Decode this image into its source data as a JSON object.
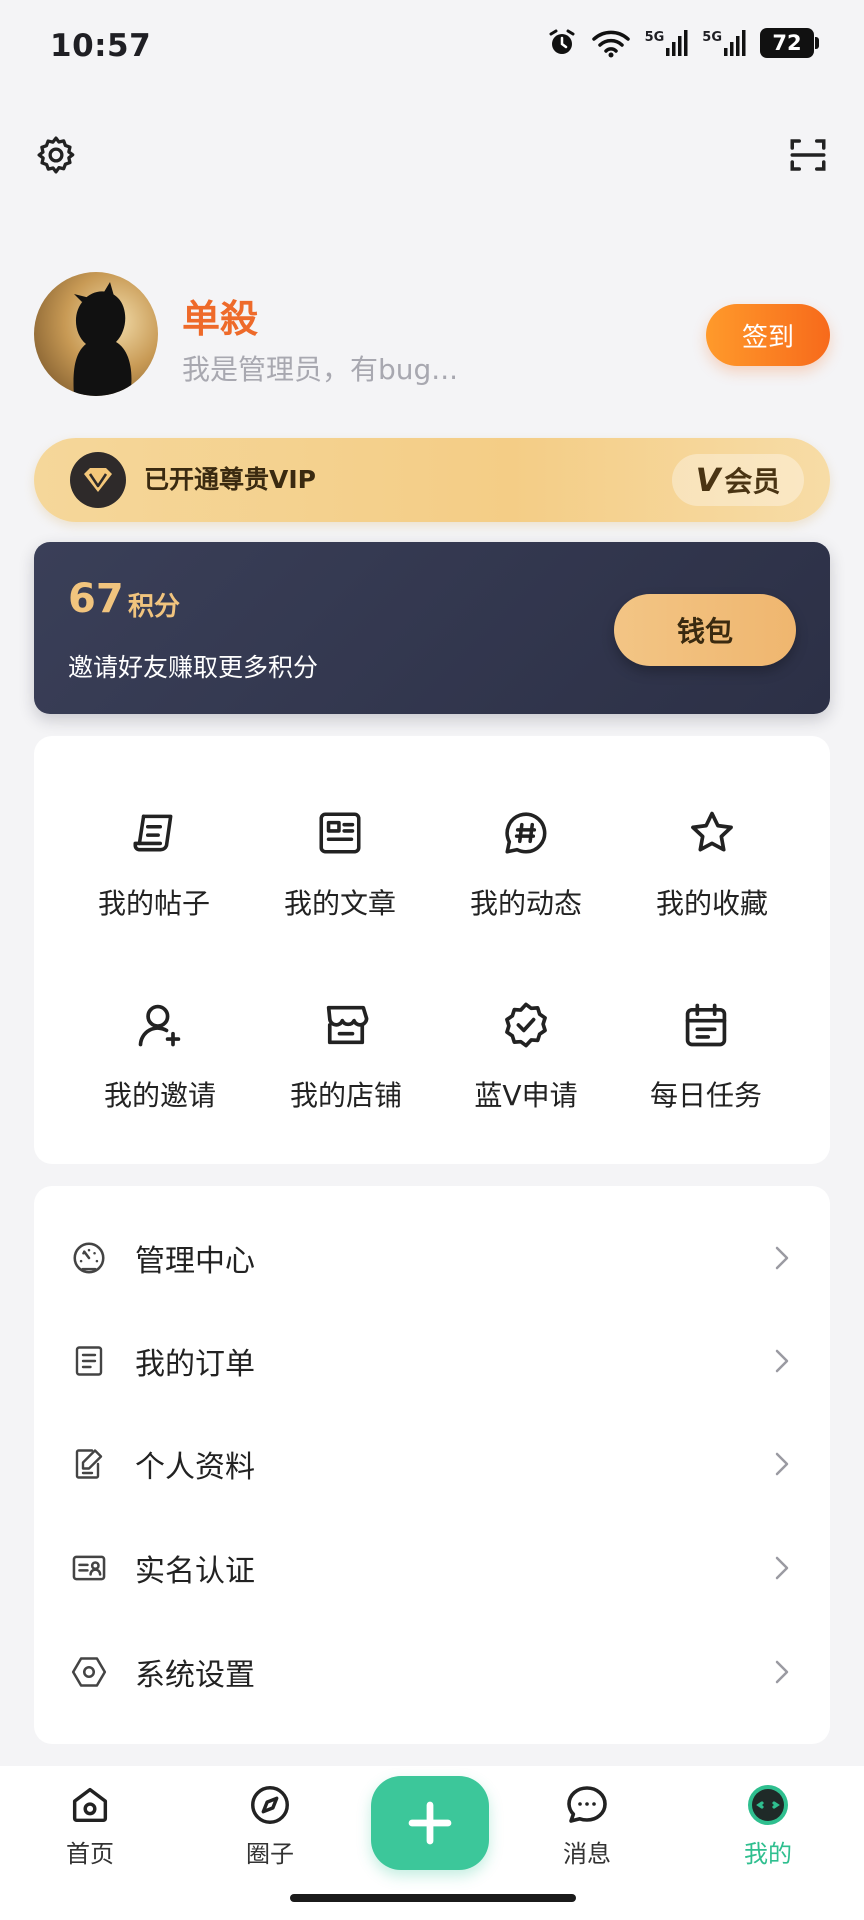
{
  "status_bar": {
    "time": "10:57",
    "battery": "72",
    "network_1": "5G",
    "network_2": "5G"
  },
  "header": {
    "settings_icon": "gear-icon",
    "scan_icon": "scan-icon"
  },
  "profile": {
    "name": "单殺",
    "bio": "我是管理员，有bug...",
    "checkin_label": "签到"
  },
  "vip": {
    "status_text": "已开通尊贵VIP",
    "tag_label": "会员",
    "tag_v": "V"
  },
  "points": {
    "value": "67",
    "unit": "积分",
    "subtitle": "邀请好友赚取更多积分",
    "wallet_label": "钱包"
  },
  "grid": {
    "items": [
      {
        "label": "我的帖子",
        "icon": "posts-icon"
      },
      {
        "label": "我的文章",
        "icon": "article-icon"
      },
      {
        "label": "我的动态",
        "icon": "hashtag-icon"
      },
      {
        "label": "我的收藏",
        "icon": "star-icon"
      },
      {
        "label": "我的邀请",
        "icon": "invite-user-icon"
      },
      {
        "label": "我的店铺",
        "icon": "store-icon"
      },
      {
        "label": "蓝V申请",
        "icon": "verified-badge-icon"
      },
      {
        "label": "每日任务",
        "icon": "calendar-task-icon"
      }
    ]
  },
  "menu": {
    "items": [
      {
        "label": "管理中心",
        "icon": "dashboard-icon"
      },
      {
        "label": "我的订单",
        "icon": "order-icon"
      },
      {
        "label": "个人资料",
        "icon": "edit-profile-icon"
      },
      {
        "label": "实名认证",
        "icon": "id-card-icon"
      },
      {
        "label": "系统设置",
        "icon": "hex-settings-icon"
      }
    ]
  },
  "tabbar": {
    "tabs": [
      {
        "label": "首页",
        "icon": "home-icon"
      },
      {
        "label": "圈子",
        "icon": "compass-icon"
      },
      {
        "label": "消息",
        "icon": "chat-icon"
      },
      {
        "label": "我的",
        "icon": "profile-face-icon"
      }
    ],
    "active_color": "#2fbf8f",
    "fab_icon": "plus-icon"
  },
  "colors": {
    "accent_orange": "#f76a1b",
    "accent_green": "#3cc79a",
    "gold": "#f1c47e",
    "card_dark": "#2c3046"
  }
}
